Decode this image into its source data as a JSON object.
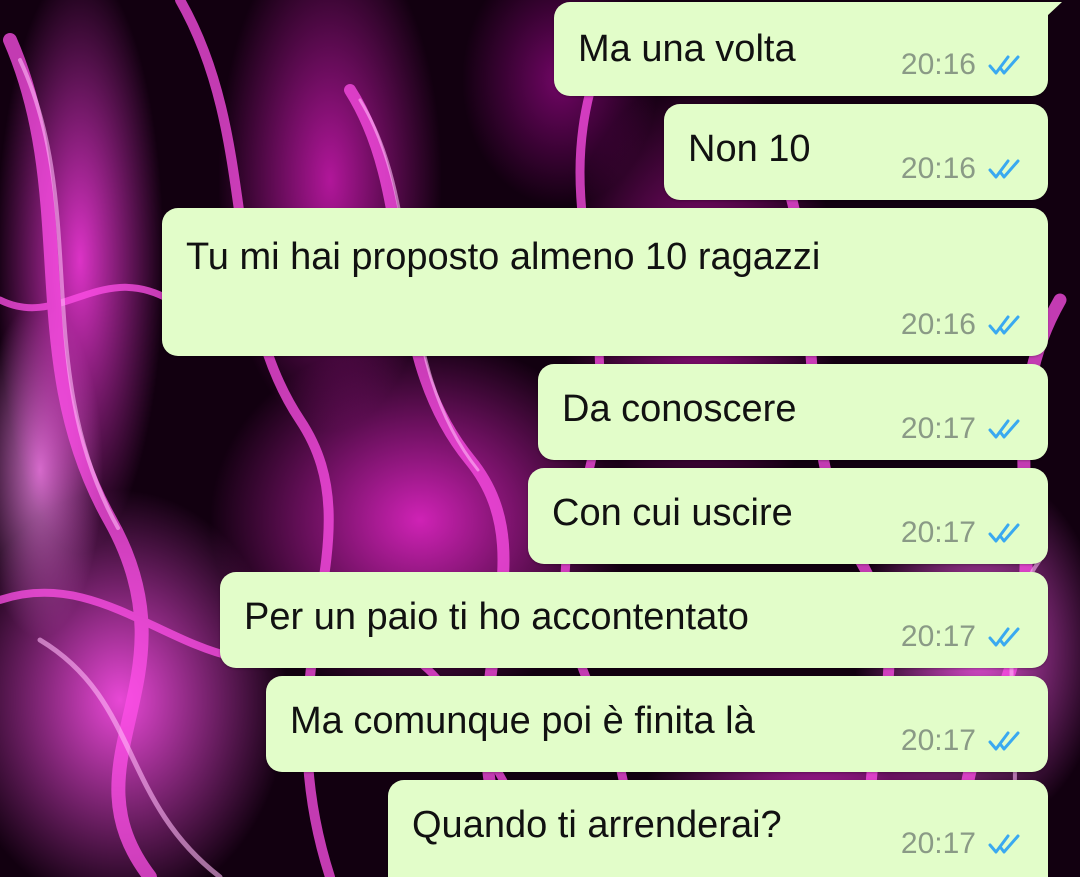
{
  "theme": {
    "bubble_color": "#e2fdc9",
    "time_color": "#8a9a86",
    "tick_color": "#3aa9f0",
    "wallpaper_base": "#120010",
    "wallpaper_accent": "#ff3ce6"
  },
  "messages": [
    {
      "text": "Ma una volta",
      "time": "20:16",
      "status": "read-double-check-icon"
    },
    {
      "text": "Non 10",
      "time": "20:16",
      "status": "read-double-check-icon"
    },
    {
      "text": "Tu mi hai proposto almeno 10 ragazzi",
      "time": "20:16",
      "status": "read-double-check-icon"
    },
    {
      "text": "Da conoscere",
      "time": "20:17",
      "status": "read-double-check-icon"
    },
    {
      "text": "Con cui uscire",
      "time": "20:17",
      "status": "read-double-check-icon"
    },
    {
      "text": "Per un paio ti ho accontentato",
      "time": "20:17",
      "status": "read-double-check-icon"
    },
    {
      "text": "Ma comunque poi è finita là",
      "time": "20:17",
      "status": "read-double-check-icon"
    },
    {
      "text": "Quando ti arrenderai?",
      "time": "20:17",
      "status": "read-double-check-icon"
    }
  ]
}
